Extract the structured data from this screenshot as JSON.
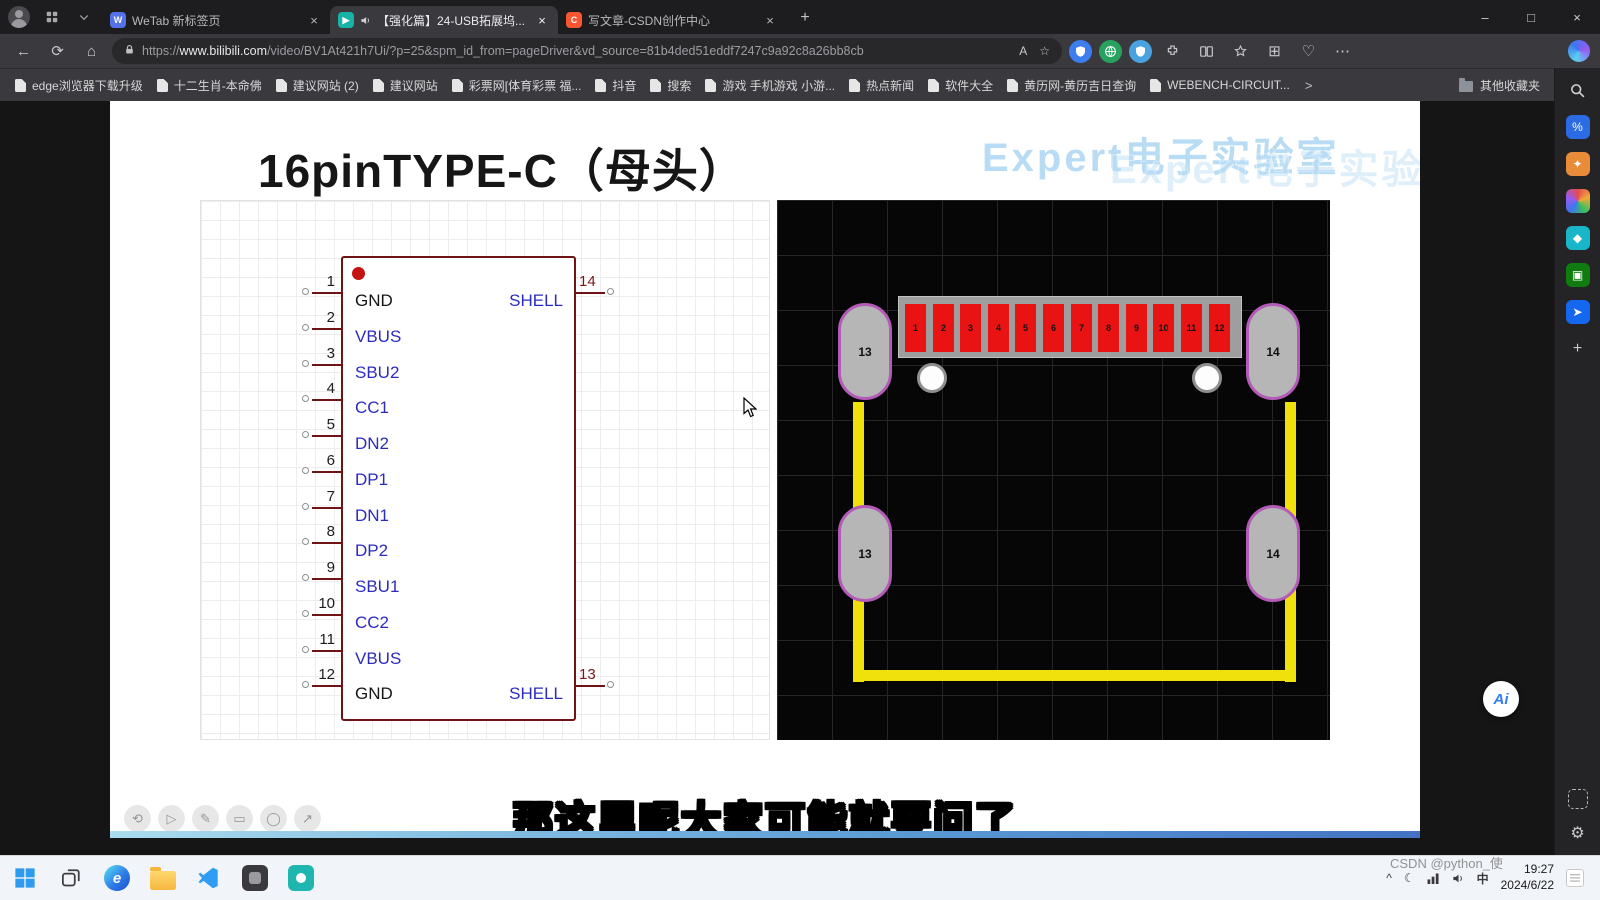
{
  "colors": {
    "pad_red": "#ea1313",
    "trace_yellow": "#f0e10c",
    "pin_maroon": "#6e1414",
    "label_blue": "#2b2bbf",
    "oval_outline": "#b45ab8"
  },
  "icons": {
    "back": "←",
    "refresh": "⟳",
    "home": "⌂",
    "new_tab": "+",
    "tab_close": "×",
    "minimize": "–",
    "maximize": "□",
    "close": "×",
    "more_menu": "⋯",
    "read_aloud": "A",
    "favorite": "☆",
    "collections": "⊞",
    "essentials": "♡",
    "bookmarks_overflow": ">",
    "tray_chevron": "^",
    "moon": "☾",
    "ime": "中",
    "settings": "⚙",
    "add": "+"
  },
  "browser": {
    "tabs": [
      {
        "badge": "W",
        "badge_bg": "#5472e8",
        "title": "WeTab 新标签页",
        "active": false,
        "audio": false
      },
      {
        "badge": "▶",
        "badge_bg": "#17b3a6",
        "title": "【强化篇】24-USB拓展坞...",
        "active": true,
        "audio": true
      },
      {
        "badge": "C",
        "badge_bg": "#fc5531",
        "title": "写文章-CSDN创作中心",
        "active": false,
        "audio": false
      }
    ],
    "address": {
      "url_prefix": "https://",
      "url_domain": "www.bilibili.com",
      "url_path": "/video/BV1At421h7Ui/?p=25&spm_id_from=pageDriver&vd_source=81b4ded51eddf7247c9a92c8a26bb8cb"
    },
    "bookmarks": [
      "edge浏览器下载升级",
      "十二生肖-本命佛",
      "建议网站 (2)",
      "建议网站",
      "彩票网[体育彩票 福...",
      "抖音",
      "搜索",
      "游戏 手机游戏 小游...",
      "热点新闻",
      "软件大全",
      "黄历网-黄历吉日查询",
      "WEBENCH-CIRCUIT..."
    ],
    "other_favorites_label": "其他收藏夹"
  },
  "sidebar": {
    "top": [
      {
        "name": "sidebar-search-icon",
        "svg": "search"
      },
      {
        "name": "sidebar-shopping-icon",
        "bg": "#2b6be4",
        "glyph": "%"
      },
      {
        "name": "sidebar-tools-icon",
        "bg": "#e98c3a",
        "glyph": "✦"
      },
      {
        "name": "sidebar-photos-icon",
        "bg": "conic",
        "glyph": ""
      },
      {
        "name": "sidebar-designer-icon",
        "bg": "#19b5c8",
        "glyph": "◆"
      },
      {
        "name": "sidebar-games-icon",
        "bg": "#107c10",
        "glyph": "▣"
      },
      {
        "name": "sidebar-send-icon",
        "bg": "#1667f0",
        "glyph": "➤"
      },
      {
        "name": "sidebar-add-icon",
        "plain": true,
        "glyph": "+"
      }
    ]
  },
  "slide": {
    "title": "16pinTYPE-C（母头）",
    "watermark": "Expert电子实验室",
    "subtitle": "那这里呢大家可能就要问了",
    "player_ghost_icons": [
      "⟲",
      "▷",
      "✎",
      "▭",
      "◯",
      "↗"
    ],
    "schematic": {
      "left_pins": [
        {
          "num": "1",
          "label": "GND",
          "c": "dark"
        },
        {
          "num": "2",
          "label": "VBUS",
          "c": "blue"
        },
        {
          "num": "3",
          "label": "SBU2",
          "c": "blue"
        },
        {
          "num": "4",
          "label": "CC1",
          "c": "blue"
        },
        {
          "num": "5",
          "label": "DN2",
          "c": "blue"
        },
        {
          "num": "6",
          "label": "DP1",
          "c": "blue"
        },
        {
          "num": "7",
          "label": "DN1",
          "c": "blue"
        },
        {
          "num": "8",
          "label": "DP2",
          "c": "blue"
        },
        {
          "num": "9",
          "label": "SBU1",
          "c": "blue"
        },
        {
          "num": "10",
          "label": "CC2",
          "c": "blue"
        },
        {
          "num": "11",
          "label": "VBUS",
          "c": "blue"
        },
        {
          "num": "12",
          "label": "GND",
          "c": "dark"
        }
      ],
      "right_pins": [
        {
          "num": "14",
          "label": "SHELL"
        },
        {
          "num": "13",
          "label": "SHELL"
        }
      ]
    },
    "pcb": {
      "pad_numbers": [
        "1",
        "2",
        "3",
        "4",
        "5",
        "6",
        "7",
        "8",
        "9",
        "10",
        "11",
        "12"
      ],
      "oval_pads": [
        {
          "label": "13",
          "pos": "top-left"
        },
        {
          "label": "14",
          "pos": "top-right"
        },
        {
          "label": "13",
          "pos": "mid-left"
        },
        {
          "label": "14",
          "pos": "mid-right"
        }
      ]
    }
  },
  "ai": {
    "label": "Ai"
  },
  "overlay": {
    "watermark": "CSDN @python_使"
  },
  "taskbar": {
    "time": "19:27",
    "date": "2024/6/22",
    "apps": [
      {
        "name": "start-button",
        "kind": "start"
      },
      {
        "name": "task-view-button",
        "kind": "taskview"
      },
      {
        "name": "taskbar-edge-icon",
        "kind": "edge",
        "glyph": "e"
      },
      {
        "name": "taskbar-explorer-icon",
        "kind": "folder"
      },
      {
        "name": "taskbar-vscode-icon",
        "kind": "vscode"
      },
      {
        "name": "taskbar-pinned-app-icon-1",
        "kind": "dark"
      },
      {
        "name": "taskbar-pinned-app-icon-2",
        "kind": "teal"
      }
    ]
  }
}
